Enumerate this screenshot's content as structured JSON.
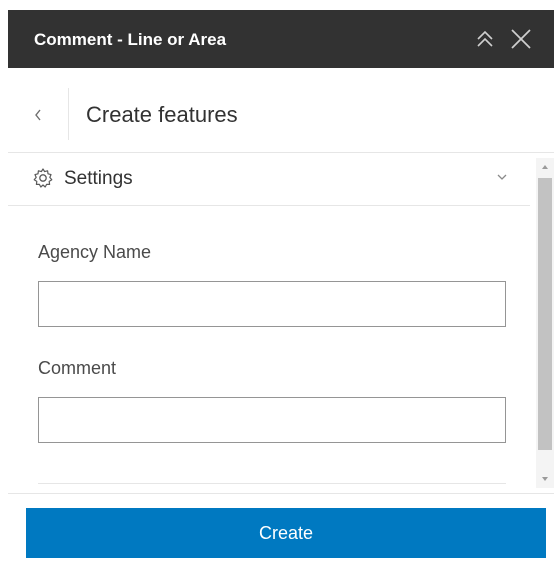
{
  "header": {
    "title": "Comment - Line or Area",
    "background": "#323232",
    "collapse_icon": "double-chevron-up-icon",
    "close_icon": "close-icon"
  },
  "subheader": {
    "back_icon": "chevron-left-icon",
    "title": "Create features"
  },
  "settings": {
    "icon": "gear-icon",
    "label": "Settings",
    "expand_icon": "chevron-down-icon"
  },
  "form": {
    "fields": [
      {
        "label": "Agency Name",
        "value": ""
      },
      {
        "label": "Comment",
        "value": ""
      }
    ]
  },
  "footer": {
    "create_label": "Create",
    "accent": "#0079c1"
  }
}
